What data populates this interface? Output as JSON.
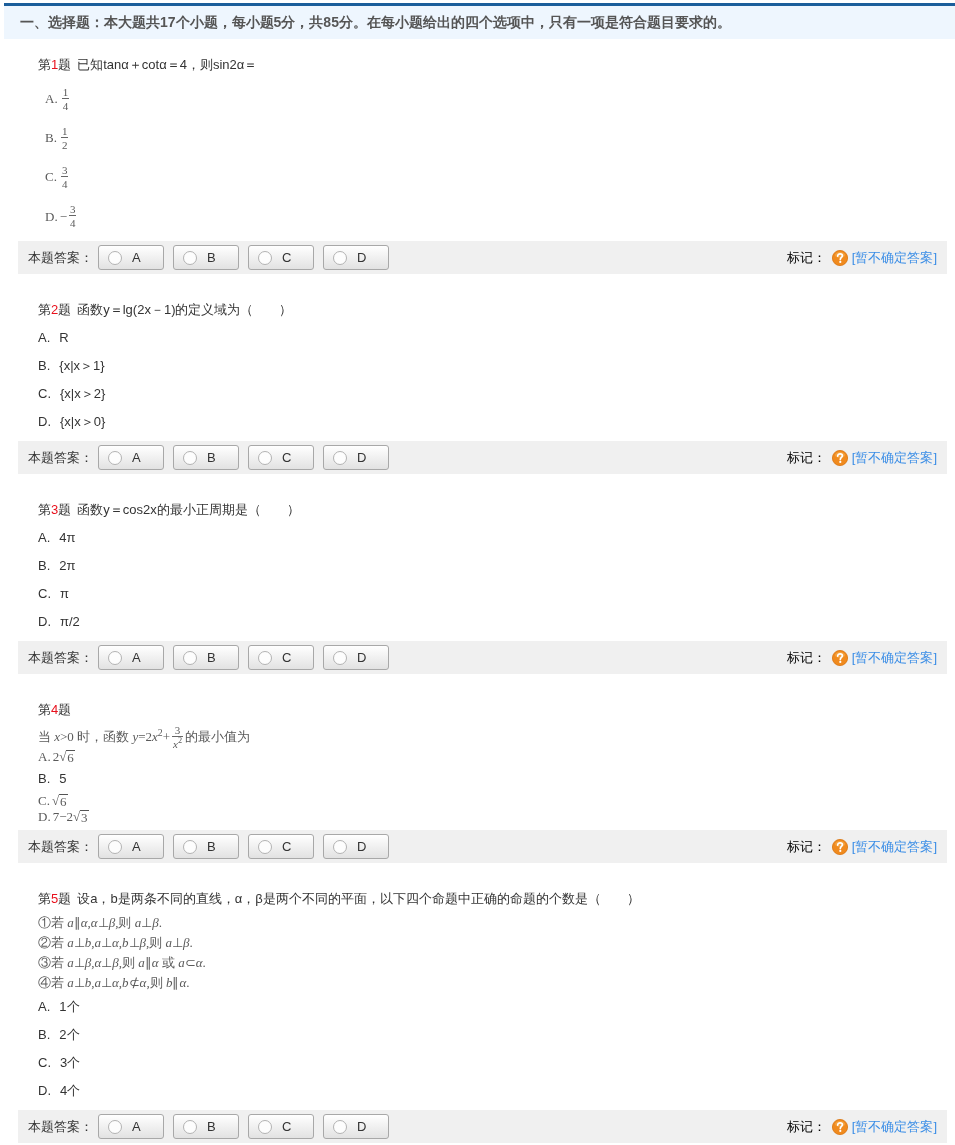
{
  "header": {
    "text": "一、选择题：本大题共17个小题，每小题5分，共85分。在每小题给出的四个选项中，只有一项是符合题目要求的。"
  },
  "questions": [
    {
      "number_prefix": "第",
      "number": "1",
      "number_suffix": "题",
      "text": "已知tanα＋cotα＝4，则sin2α＝",
      "options": [
        {
          "label": "A.",
          "kind": "formula",
          "parts": [
            {
              "kind": "frac",
              "num": "1",
              "den": "4"
            }
          ]
        },
        {
          "label": "B.",
          "kind": "formula",
          "parts": [
            {
              "kind": "frac",
              "num": "1",
              "den": "2"
            }
          ]
        },
        {
          "label": "C.",
          "kind": "formula",
          "parts": [
            {
              "kind": "frac",
              "num": "3",
              "den": "4"
            }
          ]
        },
        {
          "label": "D.",
          "kind": "formula",
          "parts": [
            {
              "kind": "text",
              "text": "−"
            },
            {
              "kind": "frac",
              "num": "3",
              "den": "4"
            }
          ]
        }
      ],
      "answer_bar": {
        "label": "本题答案：",
        "choices": [
          {
            "letter": "A",
            "selected": false
          },
          {
            "letter": "B",
            "selected": false
          },
          {
            "letter": "C",
            "selected": false
          },
          {
            "letter": "D",
            "selected": false
          }
        ],
        "mark_label": "标记：",
        "link": "[暂不确定答案]"
      }
    },
    {
      "number_prefix": "第",
      "number": "2",
      "number_suffix": "题",
      "text": "函数y＝lg(2x－1)的定义域为（　　）",
      "options": [
        {
          "label": "A.",
          "kind": "text",
          "text": "R"
        },
        {
          "label": "B.",
          "kind": "text",
          "text": "{x|x＞1}"
        },
        {
          "label": "C.",
          "kind": "text",
          "text": "{x|x＞2}"
        },
        {
          "label": "D.",
          "kind": "text",
          "text": "{x|x＞0}"
        }
      ],
      "answer_bar": {
        "label": "本题答案：",
        "choices": [
          {
            "letter": "A",
            "selected": false
          },
          {
            "letter": "B",
            "selected": false
          },
          {
            "letter": "C",
            "selected": false
          },
          {
            "letter": "D",
            "selected": false
          }
        ],
        "mark_label": "标记：",
        "link": "[暂不确定答案]"
      }
    },
    {
      "number_prefix": "第",
      "number": "3",
      "number_suffix": "题",
      "text": "函数y＝cos2x的最小正周期是（　　）",
      "options": [
        {
          "label": "A.",
          "kind": "text",
          "text": "4π"
        },
        {
          "label": "B.",
          "kind": "text",
          "text": "2π"
        },
        {
          "label": "C.",
          "kind": "text",
          "text": "π"
        },
        {
          "label": "D.",
          "kind": "text",
          "text": "π/2"
        }
      ],
      "answer_bar": {
        "label": "本题答案：",
        "choices": [
          {
            "letter": "A",
            "selected": false
          },
          {
            "letter": "B",
            "selected": false
          },
          {
            "letter": "C",
            "selected": false
          },
          {
            "letter": "D",
            "selected": false
          }
        ],
        "mark_label": "标记：",
        "link": "[暂不确定答案]"
      }
    },
    {
      "number_prefix": "第",
      "number": "4",
      "number_suffix": "题",
      "formula_lines": [
        [
          {
            "kind": "text",
            "text": "当 *x*>0 时，函数 *y*=2"
          },
          {
            "kind": "text",
            "text": "*x*$^{2}$+"
          },
          {
            "kind": "frac",
            "num": "3",
            "den": "*x*$^{2}$"
          },
          {
            "kind": "text",
            "text": "的最小值为"
          }
        ]
      ],
      "options": [
        {
          "label": "A.",
          "kind": "formula",
          "parts": [
            {
              "kind": "text",
              "text": "2√"
            },
            {
              "kind": "radicand",
              "text": "6"
            }
          ]
        },
        {
          "label": "B.",
          "kind": "text",
          "text": "5"
        },
        {
          "label": "C.",
          "kind": "formula",
          "parts": [
            {
              "kind": "text",
              "text": "√"
            },
            {
              "kind": "radicand",
              "text": "6"
            }
          ]
        },
        {
          "label": "D.",
          "kind": "formula",
          "parts": [
            {
              "kind": "text",
              "text": "7−2√"
            },
            {
              "kind": "radicand",
              "text": "3"
            }
          ]
        }
      ],
      "answer_bar": {
        "label": "本题答案：",
        "choices": [
          {
            "letter": "A",
            "selected": false
          },
          {
            "letter": "B",
            "selected": false
          },
          {
            "letter": "C",
            "selected": false
          },
          {
            "letter": "D",
            "selected": false
          }
        ],
        "mark_label": "标记：",
        "link": "[暂不确定答案]"
      }
    },
    {
      "number_prefix": "第",
      "number": "5",
      "number_suffix": "题",
      "text": "设a，b是两条不同的直线，α，β是两个不同的平面，以下四个命题中正确的命题的个数是（　　）",
      "formula_lines": [
        [
          {
            "kind": "text",
            "text": "①若 *a*∥*α*,*α*⊥*β*,则 *a*⊥*β*."
          }
        ],
        [
          {
            "kind": "text",
            "text": "②若 *a*⊥*b*,*a*⊥*α*,*b*⊥*β*,则 *a*⊥*β*."
          }
        ],
        [
          {
            "kind": "text",
            "text": "③若 *a*⊥*β*,*α*⊥*β*,则 *a*∥*α* 或 *a*⊂*α*."
          }
        ],
        [
          {
            "kind": "text",
            "text": "④若 *a*⊥*b*,*a*⊥*α*,*b*⊄*α*,则 *b*∥*α*."
          }
        ]
      ],
      "options": [
        {
          "label": "A.",
          "kind": "text",
          "text": "1个"
        },
        {
          "label": "B.",
          "kind": "text",
          "text": "2个"
        },
        {
          "label": "C.",
          "kind": "text",
          "text": "3个"
        },
        {
          "label": "D.",
          "kind": "text",
          "text": "4个"
        }
      ],
      "answer_bar": {
        "label": "本题答案：",
        "choices": [
          {
            "letter": "A",
            "selected": false
          },
          {
            "letter": "B",
            "selected": false
          },
          {
            "letter": "C",
            "selected": false
          },
          {
            "letter": "D",
            "selected": false
          }
        ],
        "mark_label": "标记：",
        "link": "[暂不确定答案]"
      }
    }
  ]
}
